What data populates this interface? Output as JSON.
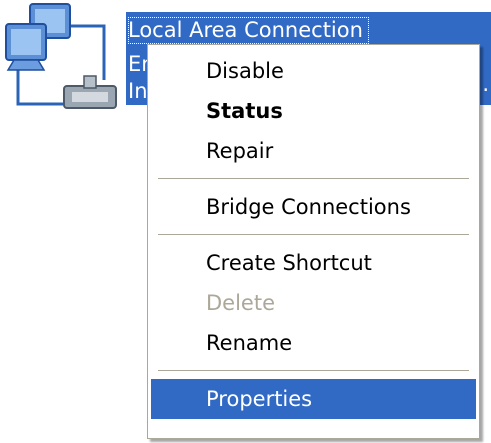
{
  "connection": {
    "icon": "network-connection-icon",
    "line1": "Local Area Connection",
    "line2": "En",
    "line3": "Int",
    "overflow": "..."
  },
  "context_menu": {
    "groups": [
      [
        "Disable",
        "Status",
        "Repair"
      ],
      [
        "Bridge Connections"
      ],
      [
        "Create Shortcut",
        "Delete",
        "Rename"
      ],
      [
        "Properties"
      ]
    ],
    "default_item": "Status",
    "disabled_item": "Delete",
    "highlighted_item": "Properties"
  },
  "colors": {
    "selection": "#316ac5",
    "disabled_text": "#aca899",
    "menu_border": "#aca899"
  }
}
